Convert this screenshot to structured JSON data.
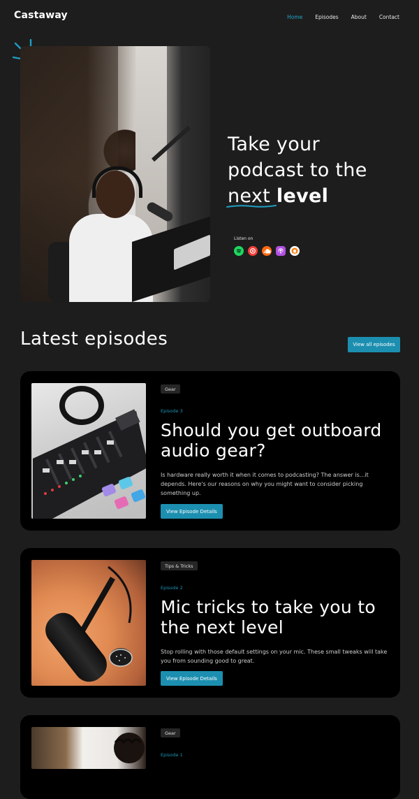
{
  "nav": {
    "brand": "Castaway",
    "links": [
      {
        "label": "Home",
        "active": true
      },
      {
        "label": "Episodes",
        "active": false
      },
      {
        "label": "About",
        "active": false
      },
      {
        "label": "Contact",
        "active": false
      }
    ]
  },
  "hero": {
    "title_line1": "Take your",
    "title_line2": "podcast to the",
    "title_next": "next",
    "title_bold": "level",
    "listen_on": "Listen on",
    "platforms": [
      {
        "icon": "spotify-icon",
        "color": "#1ed760"
      },
      {
        "icon": "pocketcasts-icon",
        "color": "#f43e37"
      },
      {
        "icon": "soundcloud-icon",
        "color": "#ff6a13"
      },
      {
        "icon": "apple-podcasts-icon",
        "color": "#b150e2"
      },
      {
        "icon": "overcast-icon",
        "color": "#fc7e0f"
      }
    ]
  },
  "latest": {
    "heading": "Latest episodes",
    "view_all": "View all episodes"
  },
  "episodes": [
    {
      "tag": "Gear",
      "number": "Episode 3",
      "title": "Should you get outboard audio gear?",
      "description": "Is hardware really worth it when it comes to podcasting? The answer is...it depends. Here's our reasons on why you might want to consider picking something up.",
      "button": "View Episode Details"
    },
    {
      "tag": "Tips & Tricks",
      "number": "Episode 2",
      "title": "Mic tricks to take you to the next level",
      "description": "Stop rolling with those default settings on your mic. These small tweaks will take you from sounding good to great.",
      "button": "View Episode Details"
    },
    {
      "tag": "Gear",
      "number": "Episode 1"
    }
  ],
  "colors": {
    "accent": "#1c8fb0",
    "background": "#1d1d1d",
    "card": "#000000"
  }
}
